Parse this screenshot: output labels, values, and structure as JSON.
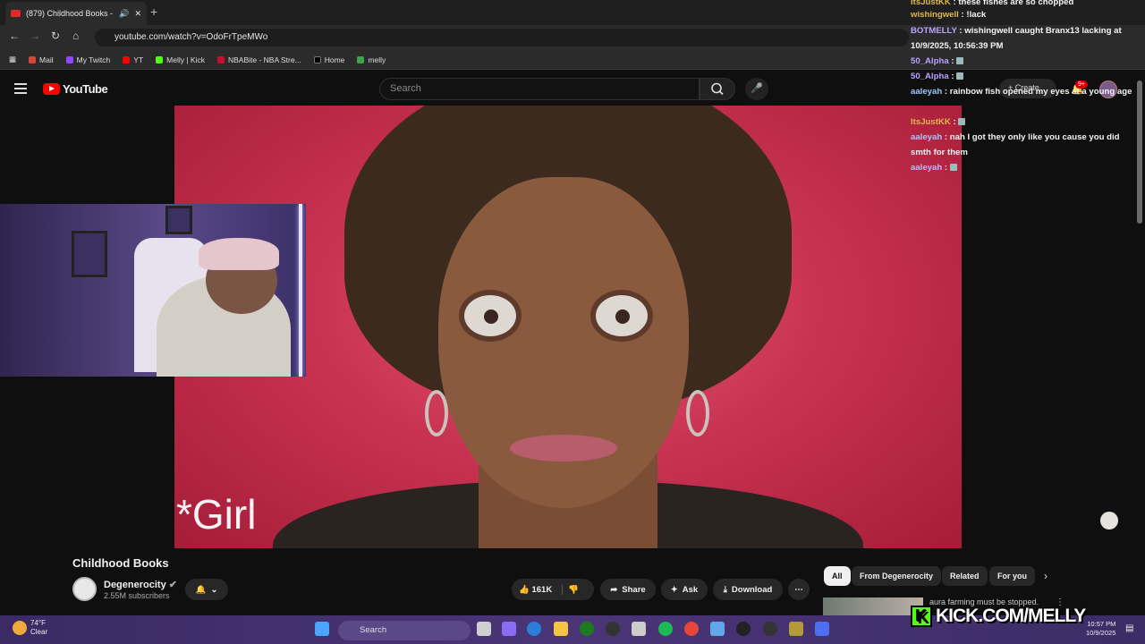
{
  "browser": {
    "tab_title": "(879) Childhood Books - Yo",
    "url": "youtube.com/watch?v=OdoFrTpeMWo",
    "bookmarks": [
      "Mail",
      "My Twitch",
      "YT",
      "Melly | Kick",
      "NBABite - NBA Stre...",
      "Home",
      "melly"
    ]
  },
  "youtube": {
    "logo": "YouTube",
    "search_placeholder": "Search",
    "create_label": "Create",
    "notif_badge": "9+"
  },
  "video": {
    "caption": "*Girl",
    "title": "Childhood Books"
  },
  "channel": {
    "name": "Degenerocity",
    "subs": "2.55M subscribers"
  },
  "actions": {
    "likes": "161K",
    "share": "Share",
    "ask": "Ask",
    "download": "Download"
  },
  "chips": [
    "All",
    "From Degenerocity",
    "Related",
    "For you"
  ],
  "reco": {
    "title": "aura farming must be stopped."
  },
  "chat": [
    {
      "user": "ItsJustKK",
      "text": "these fishes are so chopped",
      "color": "#e0b84a"
    },
    {
      "user": "wishingwell",
      "text": "!lack",
      "color": "#e0b84a"
    },
    {
      "user": "BOTMELLY",
      "text": "wishingwell caught Branx13 lacking at 10/9/2025, 10:56:39 PM",
      "color": "#b9a3ff"
    },
    {
      "user": "50_Alpha",
      "text": "",
      "color": "#b9a3ff"
    },
    {
      "user": "50_Alpha",
      "text": "",
      "color": "#b9a3ff"
    },
    {
      "user": "aaleyah",
      "text": "rainbow fish opened my eyes at a young age",
      "color": "#9ec8ff"
    },
    {
      "user": "ItsJustKK",
      "text": "",
      "color": "#e0b84a"
    },
    {
      "user": "aaleyah",
      "text": "nah I got they only like you cause you did smth for them",
      "color": "#9ec8ff"
    },
    {
      "user": "aaleyah",
      "text": "",
      "color": "#9ec8ff"
    }
  ],
  "overlay": {
    "kick_text": "KICK.COM/MELLY"
  },
  "taskbar": {
    "temp": "74°F",
    "weather": "Clear",
    "search": "Search",
    "time": "10:57 PM",
    "date": "10/9/2025"
  }
}
